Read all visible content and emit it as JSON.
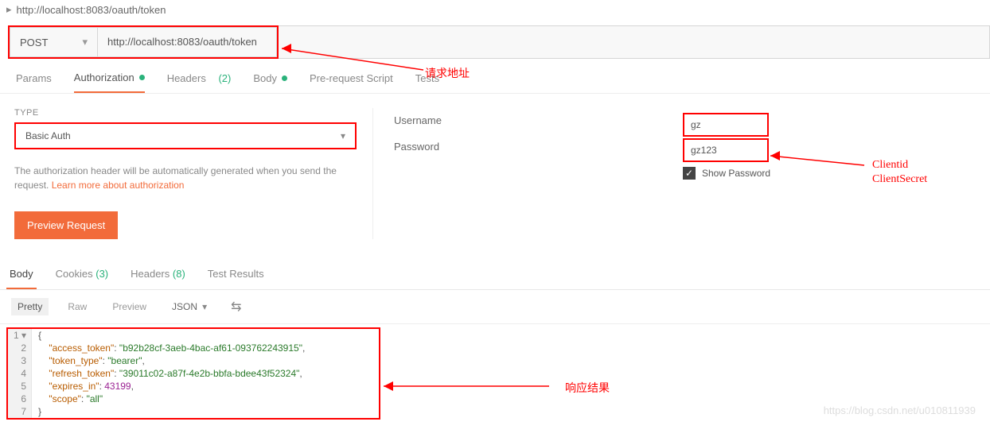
{
  "header": {
    "url_display": "http://localhost:8083/oauth/token"
  },
  "request": {
    "method": "POST",
    "url": "http://localhost:8083/oauth/token"
  },
  "req_tabs": {
    "params": "Params",
    "authorization": "Authorization",
    "headers": "Headers",
    "headers_count": "(2)",
    "body": "Body",
    "prerequest": "Pre-request Script",
    "tests": "Tests"
  },
  "auth": {
    "type_label": "TYPE",
    "type_value": "Basic Auth",
    "desc_prefix": "The authorization header will be automatically generated when you send the request. ",
    "desc_link": "Learn more about authorization",
    "preview_btn": "Preview Request",
    "username_label": "Username",
    "password_label": "Password",
    "username_value": "gz",
    "password_value": "gz123",
    "show_password": "Show Password"
  },
  "resp_tabs": {
    "body": "Body",
    "cookies": "Cookies",
    "cookies_count": "(3)",
    "headers": "Headers",
    "headers_count": "(8)",
    "test_results": "Test Results"
  },
  "viewer": {
    "pretty": "Pretty",
    "raw": "Raw",
    "preview": "Preview",
    "format": "JSON"
  },
  "response_json": {
    "access_token": "b92b28cf-3aeb-4bac-af61-093762243915",
    "token_type": "bearer",
    "refresh_token": "39011c02-a87f-4e2b-bbfa-bdee43f52324",
    "expires_in": 43199,
    "scope": "all"
  },
  "annotations": {
    "url": "请求地址",
    "creds1": "Clientid",
    "creds2": "ClientSecret",
    "response": "响应结果"
  },
  "watermark": "https://blog.csdn.net/u010811939"
}
